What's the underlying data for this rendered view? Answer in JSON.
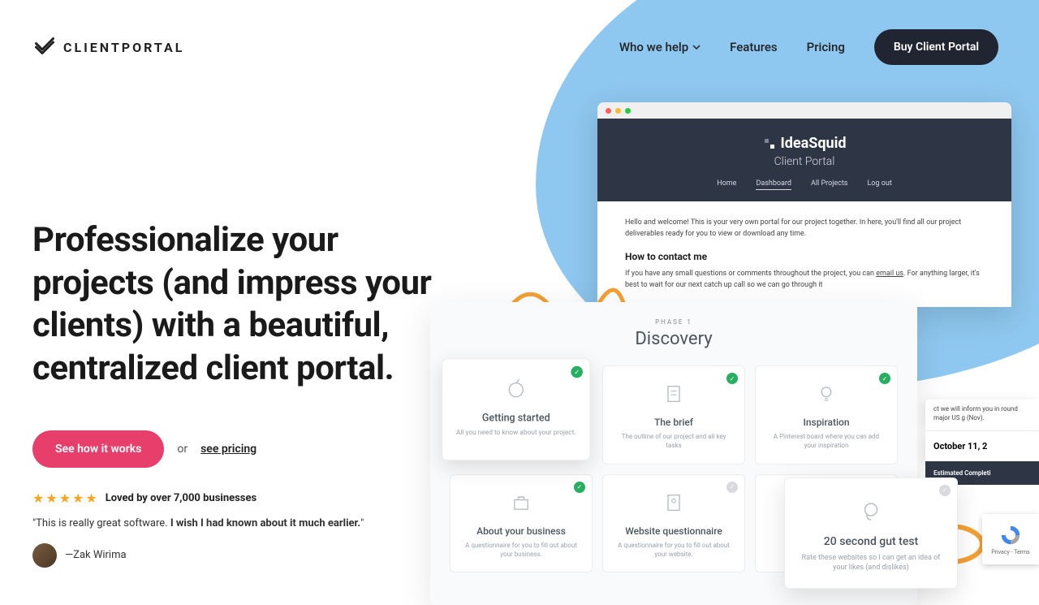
{
  "brand": "CLIENTPORTAL",
  "nav": {
    "who": "Who we help",
    "features": "Features",
    "pricing": "Pricing",
    "buy": "Buy Client Portal"
  },
  "hero": {
    "headline": "Professionalize your projects (and impress your clients) with a beautiful, centralized client portal.",
    "cta_primary": "See how it works",
    "cta_or": "or",
    "cta_secondary": "see pricing",
    "social_text": "Loved by over 7,000 businesses",
    "quote_part1": "\"This is really great software. ",
    "quote_bold": "I wish I had known about it much earlier.",
    "quote_part2": "\"",
    "author": "—Zak Wirima"
  },
  "mock": {
    "brand": "IdeaSquid",
    "subtitle": "Client Portal",
    "nav": {
      "home": "Home",
      "dashboard": "Dashboard",
      "all_projects": "All Projects",
      "logout": "Log out"
    },
    "welcome": "Hello and welcome! This is your very own portal for our project together. In here, you'll find all our project deliverables ready for you to view or download any time.",
    "contact_h": "How to contact me",
    "contact_p1": "If you have any small questions or comments throughout the project, you can ",
    "contact_link": "email us",
    "contact_p2": ". For anything larger, it's best to wait for our next catch up call so we can go through it"
  },
  "cards": {
    "phase_label": "PHASE 1",
    "phase_title": "Discovery",
    "items": [
      {
        "title": "Getting started",
        "desc": "All you need to know about your project.",
        "done": true
      },
      {
        "title": "The brief",
        "desc": "The outline of our project and all key tasks",
        "done": true
      },
      {
        "title": "Inspiration",
        "desc": "A Pinterest board where you can add your inspiration",
        "done": true
      },
      {
        "title": "About your business",
        "desc": "A questionnaire for you to fill out about your business.",
        "done": true
      },
      {
        "title": "Website questionnaire",
        "desc": "A questionnaire for you to fill out about your website.",
        "done": false
      },
      {
        "title": "",
        "desc": "",
        "done": false
      }
    ]
  },
  "popout": {
    "title": "20 second gut test",
    "desc": "Rate these websites so I can get an idea of your likes (and dislikes)"
  },
  "side": {
    "info": "ct we will inform you in round major US g (Nov).",
    "date": "October 11, 2",
    "est": "Estimated Completi"
  },
  "recaptcha": {
    "privacy": "Privacy",
    "terms": "Terms"
  }
}
